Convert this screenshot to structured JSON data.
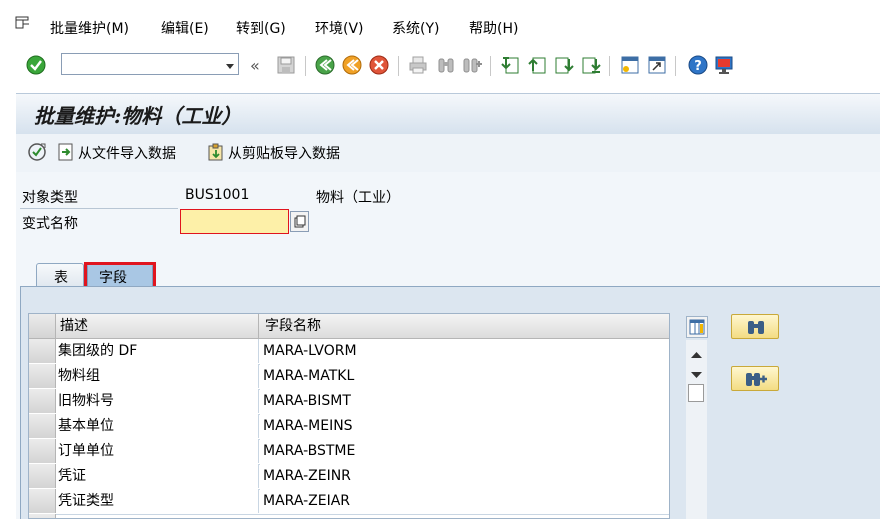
{
  "menu": {
    "items": [
      "批量维护(M)",
      "编辑(E)",
      "转到(G)",
      "环境(V)",
      "系统(Y)",
      "帮助(H)"
    ]
  },
  "toolbar": {
    "command_value": "",
    "icons": [
      "enter-icon",
      "back-double-icon",
      "save-icon",
      "back-icon",
      "exit-icon",
      "cancel-icon",
      "print-icon",
      "find-icon",
      "find-next-icon",
      "first-page-icon",
      "prev-page-icon",
      "next-page-icon",
      "last-page-icon",
      "new-session-icon",
      "shortcut-icon",
      "help-icon",
      "customize-layout-icon"
    ]
  },
  "title": "批量维护:物料（工业）",
  "app_toolbar": {
    "import_file": "从文件导入数据",
    "import_clipboard": "从剪贴板导入数据"
  },
  "form": {
    "object_type_label": "对象类型",
    "object_type_value": "BUS1001",
    "object_type_desc": "物料（工业）",
    "variant_label": "变式名称",
    "variant_value": ""
  },
  "tabs": [
    {
      "label": "表",
      "active": false
    },
    {
      "label": "字段",
      "active": true
    }
  ],
  "grid": {
    "headers": [
      "描述",
      "字段名称"
    ],
    "rows": [
      [
        "集团级的 DF",
        "MARA-LVORM"
      ],
      [
        "物料组",
        "MARA-MATKL"
      ],
      [
        "旧物料号",
        "MARA-BISMT"
      ],
      [
        "基本单位",
        "MARA-MEINS"
      ],
      [
        "订单单位",
        "MARA-BSTME"
      ],
      [
        "凭证",
        "MARA-ZEINR"
      ],
      [
        "凭证类型",
        "MARA-ZEIAR"
      ]
    ]
  },
  "colors": {
    "highlight_border": "#e0141e",
    "input_required_bg": "#fdf0a8",
    "title_bg": "#d6e2ee"
  }
}
